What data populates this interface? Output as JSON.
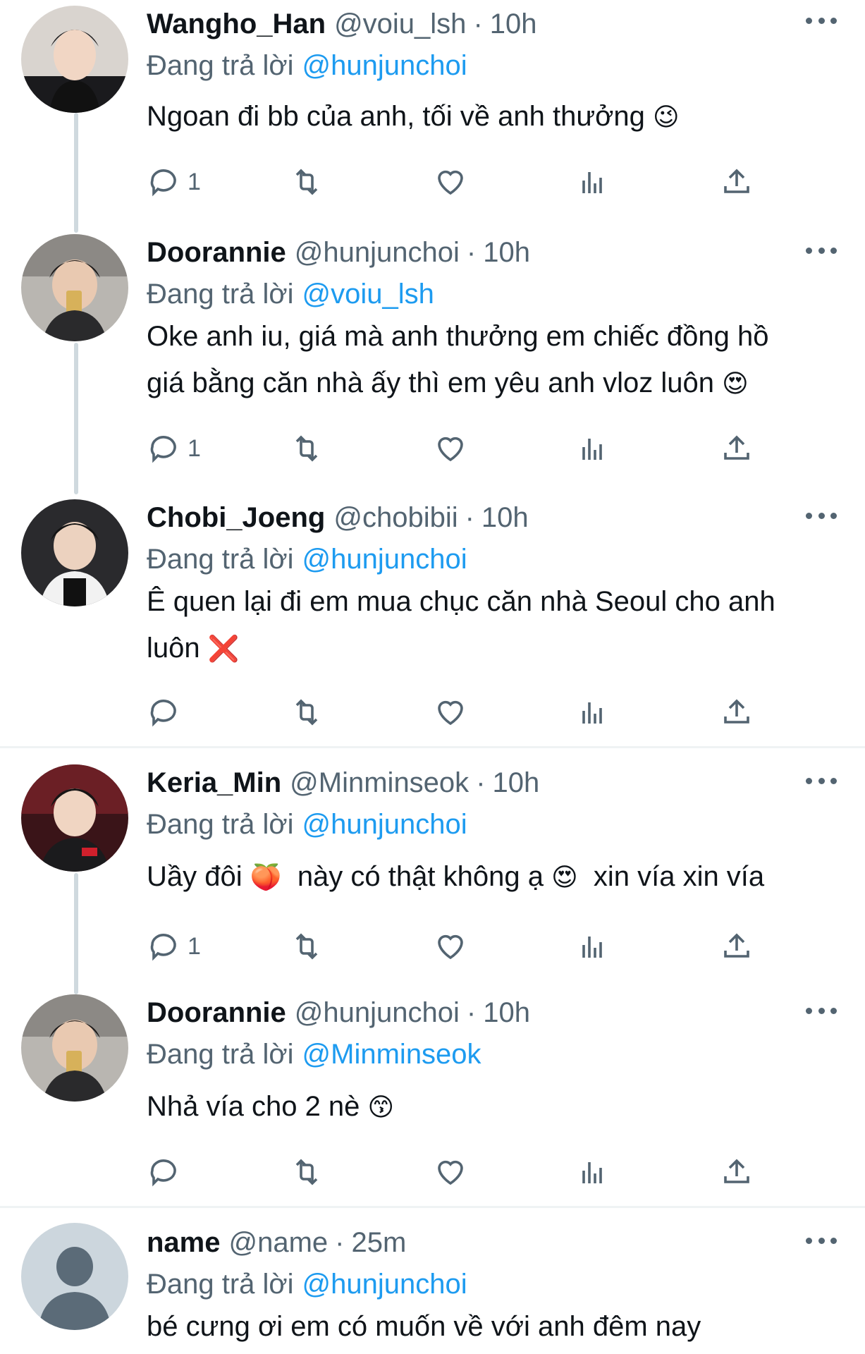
{
  "tweets": [
    {
      "name": "Wangho_Han",
      "handle": "@voiu_lsh",
      "time": "10h",
      "reply_label": "Đang trả lời",
      "reply_to": "@hunjunchoi",
      "text": "Ngoan đi bb của anh, tối về anh thưởng",
      "emoji": [
        "winking-face"
      ],
      "reply_count": "1",
      "avatar": "photo-young-man-dark-hair"
    },
    {
      "name": "Doorannie",
      "handle": "@hunjunchoi",
      "time": "10h",
      "reply_label": "Đang trả lời",
      "reply_to": "@voiu_lsh",
      "text_line1": "Oke anh iu, giá mà anh thưởng em chiếc đồng hồ",
      "text_line2": "giá bằng căn nhà ấy thì em yêu anh vloz luôn",
      "emoji": [
        "heart-eyes-face"
      ],
      "reply_count": "1",
      "avatar": "photo-boy-holding-card"
    },
    {
      "name": "Chobi_Joeng",
      "handle": "@chobibii",
      "time": "10h",
      "reply_label": "Đang trả lời",
      "reply_to": "@hunjunchoi",
      "text_line1": "Ê quen lại đi em mua chục căn nhà Seoul cho anh",
      "text_line2": "luôn",
      "emoji": [
        "cross-mark"
      ],
      "reply_count": "",
      "avatar": "photo-player-jersey"
    },
    {
      "name": "Keria_Min",
      "handle": "@Minminseok",
      "time": "10h",
      "reply_label": "Đang trả lời",
      "reply_to": "@hunjunchoi",
      "text_part1": "Uầy đôi",
      "text_part2": "này có thật không ạ",
      "text_part3": "xin vía xin vía",
      "emoji": [
        "peach",
        "heart-eyes-face"
      ],
      "reply_count": "1",
      "avatar": "photo-player-red-jersey"
    },
    {
      "name": "Doorannie",
      "handle": "@hunjunchoi",
      "time": "10h",
      "reply_label": "Đang trả lời",
      "reply_to": "@Minminseok",
      "text": "Nhả vía cho 2 nè",
      "emoji": [
        "kissing-face"
      ],
      "reply_count": "",
      "avatar": "photo-boy-holding-card"
    },
    {
      "name": "name",
      "handle": "@name",
      "time": "25m",
      "reply_label": "Đang trả lời",
      "reply_to": "@hunjunchoi",
      "text": "bé cưng ơi em có muốn về với anh đêm nay",
      "avatar": "default-avatar-silhouette"
    }
  ],
  "colors": {
    "accent": "#1d9bf0",
    "muted": "#536471",
    "thread_line": "#cfd9de",
    "separator": "#eff3f4"
  },
  "icons": [
    "reply-icon",
    "retweet-icon",
    "like-icon",
    "views-icon",
    "share-icon",
    "more-icon"
  ]
}
